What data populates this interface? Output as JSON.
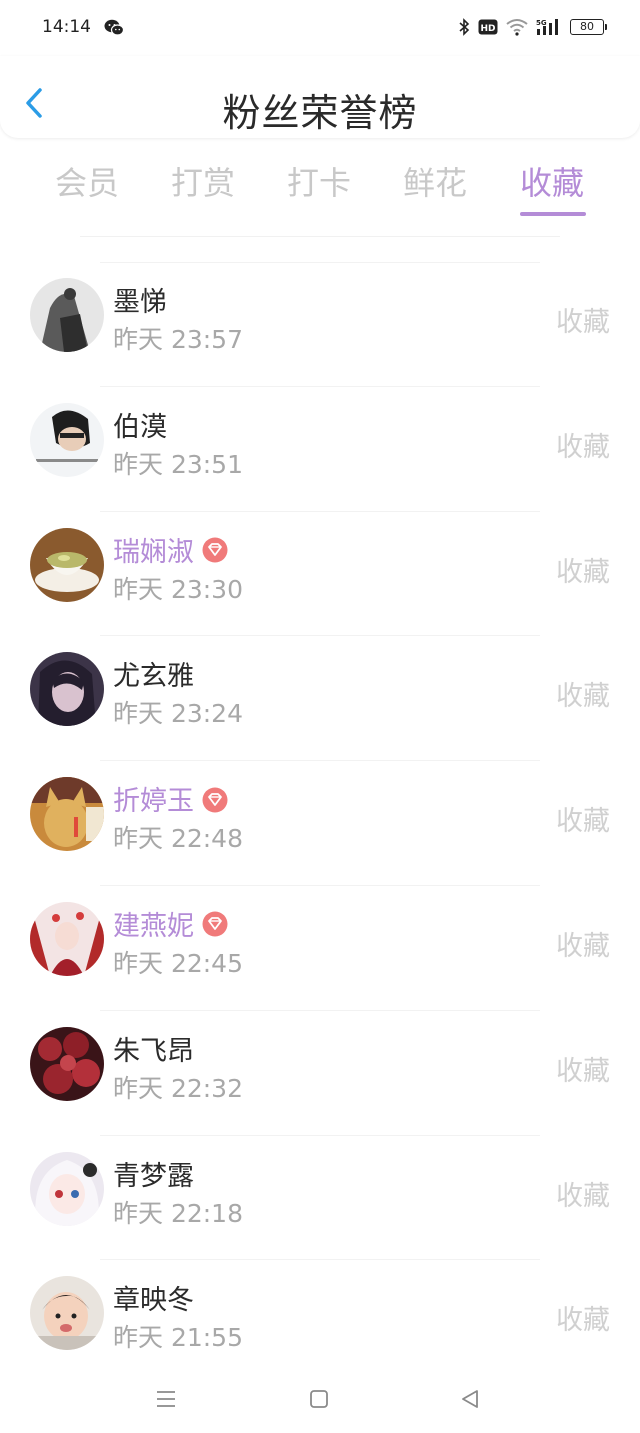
{
  "status_bar": {
    "time": "14:14",
    "icons": [
      "wechat-icon",
      "bluetooth-icon",
      "hd-icon",
      "wifi-icon",
      "signal-5g-icon",
      "battery-icon"
    ],
    "battery": "80"
  },
  "header": {
    "title": "粉丝荣誉榜",
    "back_icon": "chevron-left-icon"
  },
  "tabs": [
    {
      "label": "会员",
      "active": false
    },
    {
      "label": "打赏",
      "active": false
    },
    {
      "label": "打卡",
      "active": false
    },
    {
      "label": "鲜花",
      "active": false
    },
    {
      "label": "收藏",
      "active": true
    }
  ],
  "colors": {
    "accent": "#b48cd7",
    "back_icon": "#2b9ce6",
    "vip_badge": "#f07a7a",
    "muted_text": "#a8a8a8",
    "action_text": "#d0d0d0"
  },
  "fans": [
    {
      "name": "墨悌",
      "time": "昨天 23:57",
      "action": "收藏",
      "vip": false
    },
    {
      "name": "伯漠",
      "time": "昨天 23:51",
      "action": "收藏",
      "vip": false
    },
    {
      "name": "瑞娴淑",
      "time": "昨天 23:30",
      "action": "收藏",
      "vip": true
    },
    {
      "name": "尤玄雅",
      "time": "昨天 23:24",
      "action": "收藏",
      "vip": false
    },
    {
      "name": "折婷玉",
      "time": "昨天 22:48",
      "action": "收藏",
      "vip": true
    },
    {
      "name": "建燕妮",
      "time": "昨天 22:45",
      "action": "收藏",
      "vip": true
    },
    {
      "name": "朱飞昂",
      "time": "昨天 22:32",
      "action": "收藏",
      "vip": false
    },
    {
      "name": "青梦露",
      "time": "昨天 22:18",
      "action": "收藏",
      "vip": false
    },
    {
      "name": "章映冬",
      "time": "昨天 21:55",
      "action": "收藏",
      "vip": false
    }
  ],
  "nav_bar": {
    "buttons": [
      "menu-icon",
      "home-square-icon",
      "back-triangle-icon"
    ]
  }
}
